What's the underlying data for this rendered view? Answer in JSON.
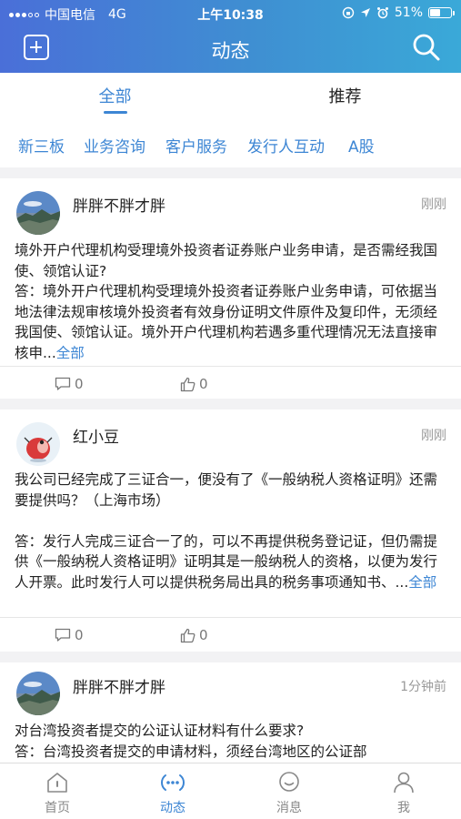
{
  "status_bar": {
    "carrier": "中国电信",
    "network": "4G",
    "time": "上午10:38",
    "battery": "51%",
    "battery_level": 0.51
  },
  "nav": {
    "title": "动态"
  },
  "tabs": [
    {
      "label": "全部"
    },
    {
      "label": "推荐"
    }
  ],
  "categories": [
    {
      "label": "新三板"
    },
    {
      "label": "业务咨询"
    },
    {
      "label": "客户服务"
    },
    {
      "label": "发行人互动"
    },
    {
      "label": "A股"
    }
  ],
  "posts": [
    {
      "user": "胖胖不胖才胖",
      "time": "刚刚",
      "question": "境外开户代理机构受理境外投资者证券账户业务申请，是否需经我国使、领馆认证?",
      "answer": "答：境外开户代理机构受理境外投资者证券账户业务申请，可依据当地法律法规审核境外投资者有效身份证明文件原件及复印件，无须经我国使、领馆认证。境外开户代理机构若遇多重代理情况无法直接审核申...",
      "more": "全部",
      "comments": "0",
      "likes": "0"
    },
    {
      "user": "红小豆",
      "time": "刚刚",
      "question": "我公司已经完成了三证合一，便没有了《一般纳税人资格证明》还需要提供吗？（上海市场）",
      "answer": "答：发行人完成三证合一了的，可以不再提供税务登记证，但仍需提供《一般纳税人资格证明》证明其是一般纳税人的资格，以便为发行人开票。此时发行人可以提供税务局出具的税务事项通知书、...",
      "more": "全部",
      "comments": "0",
      "likes": "0"
    },
    {
      "user": "胖胖不胖才胖",
      "time": "1分钟前",
      "question": "对台湾投资者提交的公证认证材料有什么要求?",
      "answer": "答：台湾投资者提交的申请材料，须经台湾地区的公证部"
    }
  ],
  "tabbar": [
    {
      "label": "首页",
      "icon": "home-icon"
    },
    {
      "label": "动态",
      "icon": "activity-icon",
      "active": true
    },
    {
      "label": "消息",
      "icon": "message-icon"
    },
    {
      "label": "我",
      "icon": "profile-icon"
    }
  ],
  "colors": {
    "accent": "#3d86d4",
    "header_gradient_start": "#4a6fd8",
    "header_gradient_end": "#3aa9d8"
  }
}
